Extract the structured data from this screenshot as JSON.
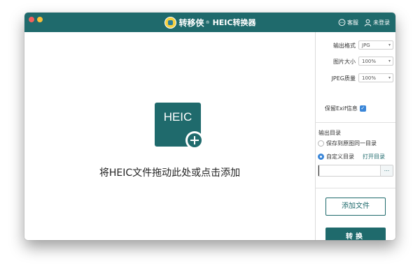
{
  "titlebar": {
    "brand": "转移侠",
    "registered": "®",
    "title": "HEIC转换器",
    "service_label": "客服",
    "login_label": "未登录"
  },
  "dropzone": {
    "icon_text": "HEIC",
    "hint": "将HEIC文件拖动此处或点击添加"
  },
  "settings": {
    "format": {
      "label": "输出格式",
      "value": "JPG"
    },
    "size": {
      "label": "图片大小",
      "value": "100%"
    },
    "quality": {
      "label": "JPEG质量",
      "value": "100%"
    },
    "exif_label": "保留Exif信息",
    "exif_checked": true
  },
  "output": {
    "title": "输出目录",
    "option_same": "保存到原图同一目录",
    "option_custom": "自定义目录",
    "selected": "custom",
    "open_dir": "打开目录",
    "path_value": "",
    "browse_label": "..."
  },
  "actions": {
    "add_files": "添加文件",
    "convert": "转换"
  },
  "colors": {
    "brand_teal": "#1f6a6c",
    "checkbox_blue": "#3a86d8",
    "logo_yellow": "#f4d03f"
  },
  "icons": [
    "close-dot",
    "minimize-dot",
    "app-logo-icon",
    "chat-icon",
    "user-icon",
    "heic-file-icon",
    "plus-circle-icon",
    "dropdown-arrow-icon",
    "check-icon"
  ]
}
